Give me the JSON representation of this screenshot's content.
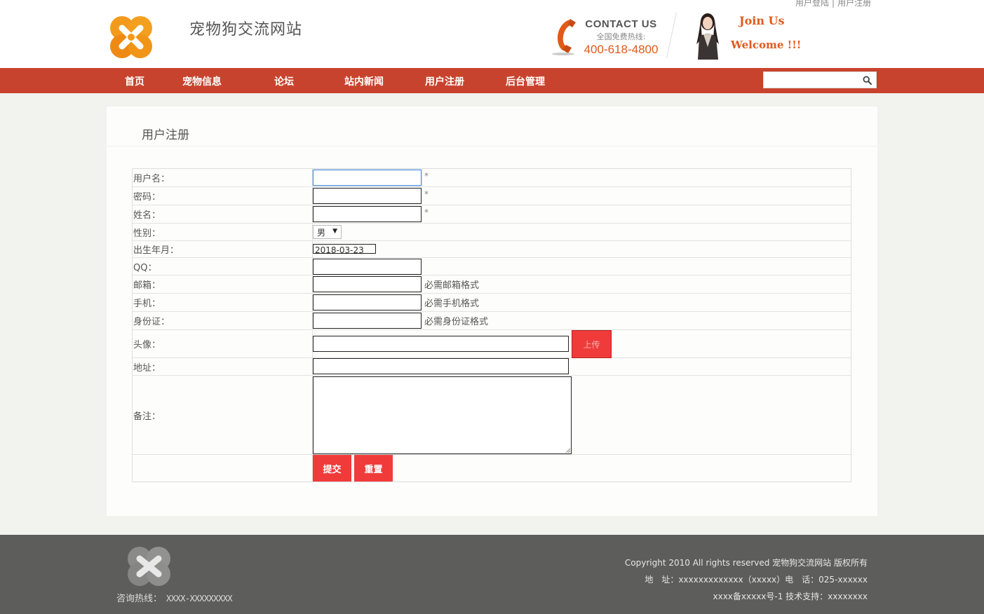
{
  "header": {
    "top_links": {
      "login": "用户登陆",
      "separator": "|",
      "register": "用户注册"
    },
    "site_title": "宠物狗交流网站",
    "contact_title": "CONTACT US",
    "hotline_label": "全国免费热线:",
    "hotline_number": "400-618-4800",
    "join_text": "Join Us",
    "welcome_text": "Welcome !!!"
  },
  "nav": {
    "items": [
      {
        "label": "首页"
      },
      {
        "label": "宠物信息"
      },
      {
        "label": "论坛"
      },
      {
        "label": "站内新闻"
      },
      {
        "label": "用户注册"
      },
      {
        "label": "后台管理"
      }
    ],
    "search_placeholder": "",
    "search_value": ""
  },
  "panel": {
    "title": "用户注册"
  },
  "form": {
    "username_label": "用户名：",
    "password_label": "密码：",
    "realname_label": "姓名：",
    "gender_label": "性别：",
    "gender_value": "男",
    "birthday_label": "出生年月：",
    "birthday_value": "2018-03-23",
    "qq_label": "QQ：",
    "email_label": "邮箱：",
    "email_hint": "必需邮箱格式",
    "phone_label": "手机：",
    "phone_hint": "必需手机格式",
    "idcard_label": "身份证：",
    "idcard_hint": "必需身份证格式",
    "avatar_label": "头像：",
    "upload_button": "上传",
    "address_label": "地址：",
    "remark_label": "备注：",
    "required_mark": "*",
    "submit_button": "提交",
    "reset_button": "重置"
  },
  "footer": {
    "hotline_label": "咨询热线：",
    "hotline_number": "XXXX-XXXXXXXXX",
    "copyright": "Copyright 2010 All rights reserved 宠物狗交流网站 版权所有",
    "address_line": "地　址：xxxxxxxxxxxxx（xxxxx）电　话：025-xxxxxx",
    "icp_line": "xxxx备xxxxx号-1 技术支持：xxxxxxxx"
  },
  "colors": {
    "nav_bg": "#c8432e",
    "accent_orange": "#e05a1a",
    "button_red": "#f03b3b",
    "footer_bg": "#5d5d5b",
    "page_bg": "#f2f2ef"
  }
}
